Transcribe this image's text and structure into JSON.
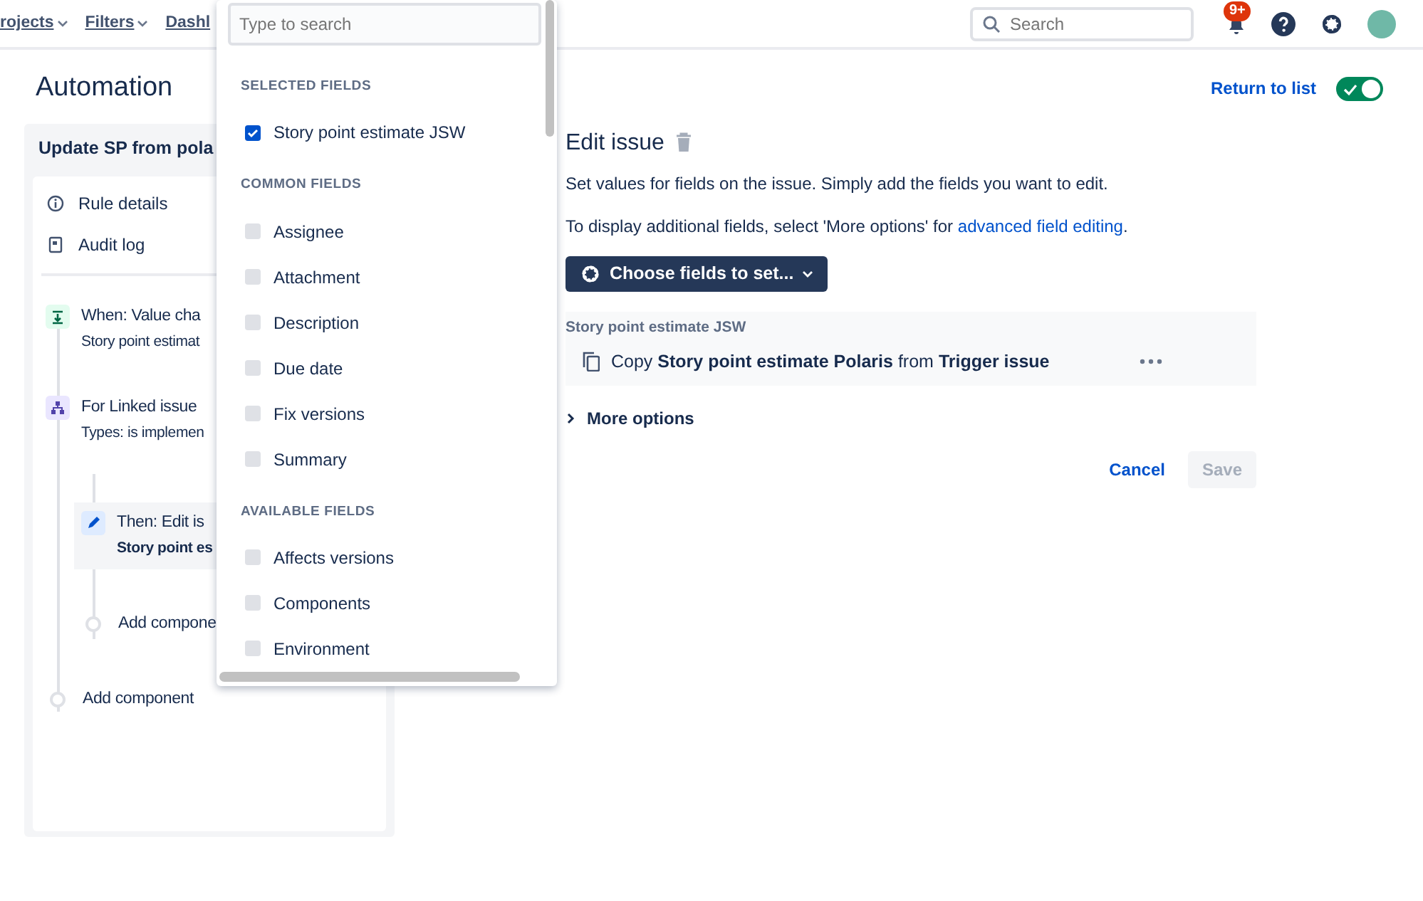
{
  "top_nav": {
    "items": [
      {
        "label": "rojects",
        "caret": true
      },
      {
        "label": "Filters",
        "caret": true
      },
      {
        "label": "Dashl",
        "caret": false
      }
    ],
    "search": {
      "placeholder": "Search"
    },
    "notifications": {
      "badge": "9+"
    }
  },
  "page": {
    "title": "Automation",
    "return_link": "Return to list",
    "rule_enabled": true
  },
  "rule": {
    "title": "Update SP from pola",
    "nav": [
      {
        "label": "Rule details",
        "kind": "info"
      },
      {
        "label": "Audit log",
        "kind": "log"
      }
    ],
    "steps": [
      {
        "kind": "trigger",
        "title": "When: Value cha",
        "subtitle": "Story point estimat",
        "selected": false
      },
      {
        "kind": "branch",
        "title": "For Linked issue",
        "subtitle": "Types: is implemen",
        "selected": false,
        "children": [
          {
            "kind": "action",
            "title": "Then: Edit is",
            "subtitle": "Story point es",
            "selected": true
          },
          {
            "kind": "add",
            "title": "Add compone",
            "selected": false
          }
        ]
      },
      {
        "kind": "add",
        "title": "Add component",
        "selected": false
      }
    ]
  },
  "field_picker": {
    "placeholder": "Type to search",
    "sections": [
      {
        "heading": "SELECTED FIELDS",
        "fields": [
          {
            "label": "Story point estimate JSW",
            "checked": true
          }
        ]
      },
      {
        "heading": "COMMON FIELDS",
        "fields": [
          {
            "label": "Assignee",
            "checked": false
          },
          {
            "label": "Attachment",
            "checked": false
          },
          {
            "label": "Description",
            "checked": false
          },
          {
            "label": "Due date",
            "checked": false
          },
          {
            "label": "Fix versions",
            "checked": false
          },
          {
            "label": "Summary",
            "checked": false
          }
        ]
      },
      {
        "heading": "AVAILABLE FIELDS",
        "fields": [
          {
            "label": "Affects versions",
            "checked": false
          },
          {
            "label": "Components",
            "checked": false
          },
          {
            "label": "Environment",
            "checked": false
          }
        ]
      }
    ]
  },
  "editor": {
    "title": "Edit issue",
    "description": "Set values for fields on the issue. Simply add the fields you want to edit.",
    "hint": "To display additional fields, select 'More options' for ",
    "hint_link": "advanced field editing",
    "hint_end": ".",
    "choose_button": "Choose fields to set...",
    "field": {
      "label": "Story point estimate JSW",
      "value": "Copy **Story point estimate Polaris** from **Trigger issue**"
    },
    "more_options": {
      "label": "More options",
      "expanded": false
    },
    "cancel": "Cancel",
    "save": {
      "label": "Save",
      "disabled": true
    }
  }
}
